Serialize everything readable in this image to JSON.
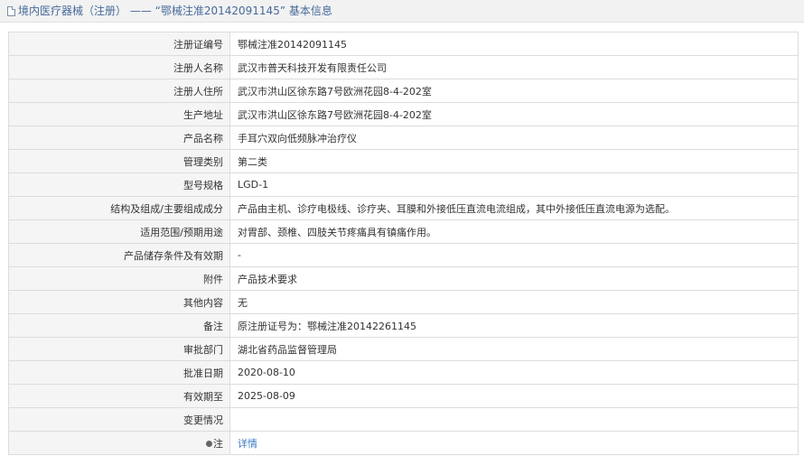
{
  "header": {
    "title": "境内医疗器械（注册） —— “鄂械注准20142091145” 基本信息"
  },
  "rows": [
    {
      "label": "注册证编号",
      "value": "鄂械注准20142091145"
    },
    {
      "label": "注册人名称",
      "value": "武汉市普天科技开发有限责任公司"
    },
    {
      "label": "注册人住所",
      "value": "武汉市洪山区徐东路7号欧洲花园8-4-202室"
    },
    {
      "label": "生产地址",
      "value": "武汉市洪山区徐东路7号欧洲花园8-4-202室"
    },
    {
      "label": "产品名称",
      "value": "手耳穴双向低频脉冲治疗仪"
    },
    {
      "label": "管理类别",
      "value": "第二类"
    },
    {
      "label": "型号规格",
      "value": "LGD-1"
    },
    {
      "label": "结构及组成/主要组成成分",
      "value": "产品由主机、诊疗电极线、诊疗夹、耳膜和外接低压直流电流组成，其中外接低压直流电源为选配。"
    },
    {
      "label": "适用范围/预期用途",
      "value": "对胃部、颈椎、四肢关节疼痛具有镇痛作用。"
    },
    {
      "label": "产品储存条件及有效期",
      "value": "-"
    },
    {
      "label": "附件",
      "value": "产品技术要求"
    },
    {
      "label": "其他内容",
      "value": "无"
    },
    {
      "label": "备注",
      "value": "原注册证号为：鄂械注准20142261145"
    },
    {
      "label": "审批部门",
      "value": "湖北省药品监督管理局"
    },
    {
      "label": "批准日期",
      "value": "2020-08-10"
    },
    {
      "label": "有效期至",
      "value": "2025-08-09"
    },
    {
      "label": "变更情况",
      "value": ""
    }
  ],
  "note_row": {
    "label": "注",
    "link_text": "详情",
    "icon": "pin-icon"
  },
  "colors": {
    "title_text": "#466a9a",
    "label_bg": "#f5f5f5",
    "border": "#dcdcdc",
    "link": "#3b79c4"
  }
}
